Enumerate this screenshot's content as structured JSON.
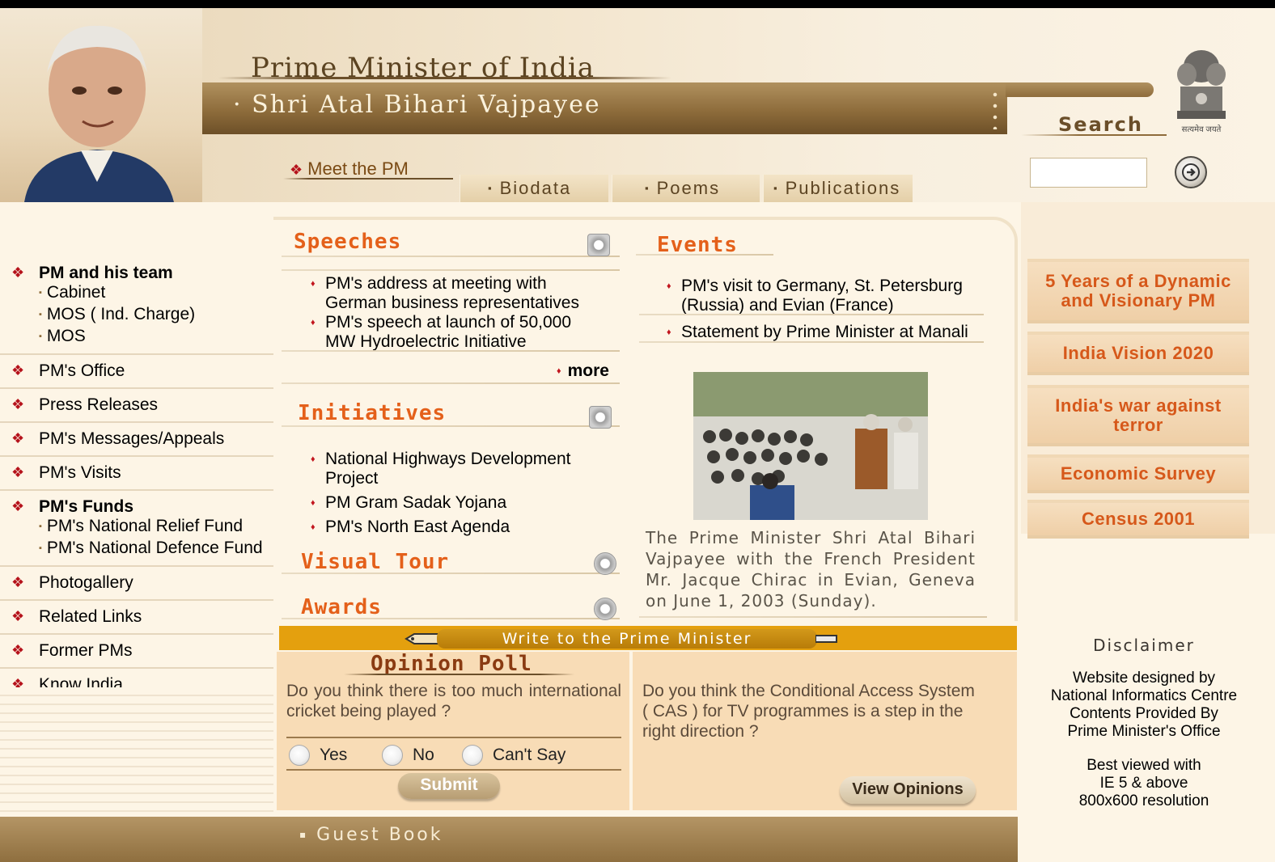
{
  "header": {
    "title": "Prime Minister of India",
    "name": "Shri Atal Bihari Vajpayee",
    "emblem_caption": "सत्यमेव जयते"
  },
  "search": {
    "label": "Search",
    "placeholder": "",
    "value": ""
  },
  "subnav": {
    "meet_pm": "Meet the PM",
    "items": [
      "Biodata",
      "Poems",
      "Publications"
    ]
  },
  "sidebar": {
    "groups": [
      {
        "label": "PM and his team",
        "bold": true,
        "children": [
          "Cabinet",
          "MOS ( Ind. Charge)",
          "MOS"
        ]
      },
      {
        "label": "PM's Office"
      },
      {
        "label": "Press Releases"
      },
      {
        "label": "PM's Messages/Appeals"
      },
      {
        "label": "PM's Visits"
      },
      {
        "label": "PM's Funds",
        "bold": true,
        "children": [
          "PM's National Relief Fund",
          "PM's National Defence Fund"
        ]
      },
      {
        "label": "Photogallery"
      },
      {
        "label": "Related Links"
      },
      {
        "label": "Former PMs"
      },
      {
        "label": "Know India"
      }
    ]
  },
  "speeches": {
    "title": "Speeches",
    "items": [
      "PM's address at meeting with",
      "German business representatives",
      "PM's speech at launch of 50,000",
      "MW Hydroelectric Initiative"
    ],
    "more": "more"
  },
  "initiatives": {
    "title": "Initiatives",
    "items": [
      "National Highways Development",
      "Project",
      "PM Gram Sadak Yojana",
      "PM's North East Agenda"
    ]
  },
  "visual_tour": {
    "title": "Visual Tour"
  },
  "awards": {
    "title": "Awards"
  },
  "events": {
    "title": "Events",
    "items": [
      "PM's visit to Germany, St. Petersburg",
      "(Russia) and Evian (France)",
      "Statement by Prime Minister at Manali"
    ],
    "caption": "The Prime Minister Shri Atal Bihari Vajpayee with the French President Mr. Jacque Chirac in Evian, Geneva on June 1, 2003 (Sunday)."
  },
  "right_links": [
    "5 Years of a Dynamic and Visionary PM",
    "India Vision 2020",
    "India's war against terror",
    "Economic Survey",
    "Census 2001"
  ],
  "write_to_pm": "Write to the Prime Minister",
  "poll": {
    "title": "Opinion Poll",
    "question": "Do you think there is too much international cricket being played ?",
    "options": [
      "Yes",
      "No",
      "Can't Say"
    ],
    "submit": "Submit",
    "question2": "Do you think the Conditional Access System ( CAS ) for TV programmes is a step in the right direction ?",
    "view_opinions": "View Opinions"
  },
  "disclaimer": {
    "title": "Disclaimer",
    "lines": [
      "Website designed by",
      "National Informatics Centre",
      "Contents Provided By",
      "Prime Minister's Office",
      "",
      "Best viewed with",
      "IE 5 & above",
      "800x600 resolution"
    ]
  },
  "guest_book": "Guest Book",
  "colors": {
    "accent_orange": "#e4601a",
    "bullet_red": "#b5121b",
    "band_brown": "#8e6c3b",
    "write_bar": "#e4a00e"
  },
  "icons": [
    "diamond-bullet-icon",
    "go-arrow-icon",
    "external-link-icon",
    "national-emblem-icon",
    "pen-icon"
  ]
}
